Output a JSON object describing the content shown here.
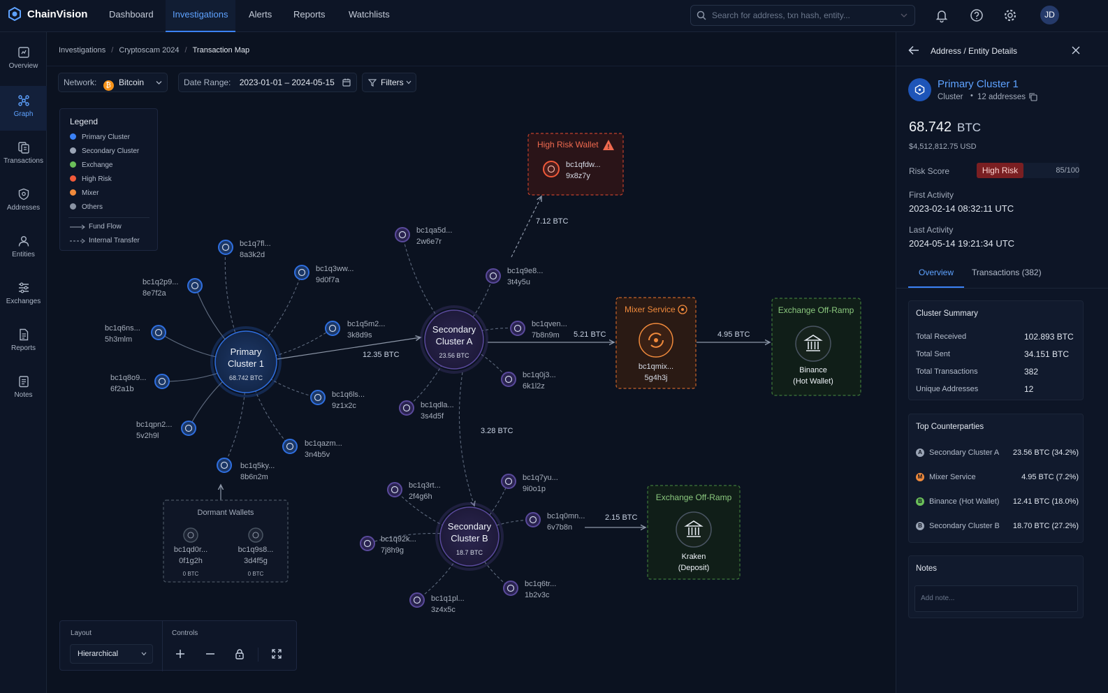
{
  "app": {
    "name": "ChainVision"
  },
  "nav": {
    "items": [
      "Dashboard",
      "Investigations",
      "Alerts",
      "Reports",
      "Watchlists"
    ],
    "active": "Investigations"
  },
  "search": {
    "placeholder": "Search for address, txn hash, entity..."
  },
  "user": {
    "initials": "JD"
  },
  "sidebar": {
    "items": [
      {
        "label": "Overview",
        "icon": "overview-icon"
      },
      {
        "label": "Graph",
        "icon": "graph-icon",
        "active": true
      },
      {
        "label": "Transactions",
        "icon": "transactions-icon"
      },
      {
        "label": "Addresses",
        "icon": "addresses-icon"
      },
      {
        "label": "Entities",
        "icon": "entities-icon"
      },
      {
        "label": "Exchanges",
        "icon": "exchanges-icon"
      },
      {
        "label": "Reports",
        "icon": "reports-icon"
      },
      {
        "label": "Notes",
        "icon": "notes-icon"
      }
    ]
  },
  "breadcrumb": [
    "Investigations",
    "Cryptoscam 2024",
    "Transaction Map"
  ],
  "toolbar": {
    "network_label": "Network:",
    "network_value": "Bitcoin",
    "date_label": "Date Range:",
    "date_value": "2023-01-01 – 2024-05-15",
    "filters_label": "Filters"
  },
  "legend": {
    "title": "Legend",
    "items": [
      {
        "label": "Primary Cluster",
        "color": "#3b82f6"
      },
      {
        "label": "Secondary Cluster",
        "color": "#9aa4b5"
      },
      {
        "label": "Exchange",
        "color": "#6bbf59"
      },
      {
        "label": "High Risk",
        "color": "#f15a3a"
      },
      {
        "label": "Mixer",
        "color": "#f08a3c"
      },
      {
        "label": "Others",
        "color": "#8a93a3"
      }
    ],
    "fund_flow": "Fund Flow",
    "internal_transfer": "Internal Transfer"
  },
  "graph": {
    "primary": {
      "name1": "Primary",
      "name2": "Cluster 1",
      "amount": "68.742 BTC"
    },
    "secondary_a": {
      "name1": "Secondary",
      "name2": "Cluster A",
      "amount": "23.56 BTC"
    },
    "secondary_b": {
      "name1": "Secondary",
      "name2": "Cluster B",
      "amount": "18.7 BTC"
    },
    "primary_nodes": [
      {
        "l1": "bc1q7fl...",
        "l2": "8a3k2d"
      },
      {
        "l1": "bc1q3ww...",
        "l2": "9d0f7a"
      },
      {
        "l1": "bc1q2p9...",
        "l2": "8e7f2a"
      },
      {
        "l1": "bc1q6ns...",
        "l2": "5h3mlm"
      },
      {
        "l1": "bc1q5m2...",
        "l2": "3k8d9s"
      },
      {
        "l1": "bc1q8o9...",
        "l2": "6f2a1b"
      },
      {
        "l1": "bc1q6ls...",
        "l2": "9z1x2c"
      },
      {
        "l1": "bc1qpn2...",
        "l2": "5v2h9l"
      },
      {
        "l1": "bc1qazm...",
        "l2": "3n4b5v"
      },
      {
        "l1": "bc1q5ky...",
        "l2": "8b6n2m"
      }
    ],
    "a_nodes": [
      {
        "l1": "bc1qa5d...",
        "l2": "2w6e7r"
      },
      {
        "l1": "bc1q9e8...",
        "l2": "3t4y5u"
      },
      {
        "l1": "bc1qven...",
        "l2": "7b8n9m"
      },
      {
        "l1": "bc1q0j3...",
        "l2": "6k1l2z"
      },
      {
        "l1": "bc1qdla...",
        "l2": "3s4d5f"
      }
    ],
    "b_nodes": [
      {
        "l1": "bc1q3rt...",
        "l2": "2f4g6h"
      },
      {
        "l1": "bc1q7yu...",
        "l2": "9i0o1p"
      },
      {
        "l1": "bc1q0mn...",
        "l2": "6v7b8n"
      },
      {
        "l1": "bc1q92k...",
        "l2": "7j8h9g"
      },
      {
        "l1": "bc1q6tr...",
        "l2": "1b2v3c"
      },
      {
        "l1": "bc1q1pl...",
        "l2": "3z4x5c"
      }
    ],
    "edges": {
      "p_to_a": "12.35 BTC",
      "a_to_risk": "7.12 BTC",
      "a_to_mixer": "5.21 BTC",
      "mixer_to_exchange": "4.95 BTC",
      "a_to_b": "3.28 BTC",
      "b_to_kraken": "2.15 BTC"
    },
    "high_risk": {
      "title": "High Risk Wallet",
      "l1": "bc1qfdw...",
      "l2": "9x8z7y"
    },
    "mixer": {
      "title": "Mixer Service",
      "l1": "bc1qmix...",
      "l2": "5g4h3j"
    },
    "binance": {
      "title": "Exchange Off-Ramp",
      "l1": "Binance",
      "l2": "(Hot Wallet)"
    },
    "kraken": {
      "title": "Exchange Off-Ramp",
      "l1": "Kraken",
      "l2": "(Deposit)"
    },
    "dormant": {
      "title": "Dormant Wallets",
      "wallets": [
        {
          "l1": "bc1qd0r...",
          "l2": "0f1g2h",
          "amt": "0 BTC"
        },
        {
          "l1": "bc1q9s8...",
          "l2": "3d4f5g",
          "amt": "0 BTC"
        }
      ]
    }
  },
  "layout_panel": {
    "title": "Layout",
    "value": "Hierarchical",
    "controls_title": "Controls"
  },
  "details": {
    "header": "Address / Entity Details",
    "entity_name": "Primary Cluster 1",
    "entity_type": "Cluster",
    "entity_count": "12 addresses",
    "balance": "68.742",
    "unit": "BTC",
    "usd": "$4,512,812.75 USD",
    "risk_label": "Risk Score",
    "risk_badge": "High Risk",
    "risk_score": "85/100",
    "first_label": "First Activity",
    "first_value": "2023-02-14 08:32:11 UTC",
    "last_label": "Last Activity",
    "last_value": "2024-05-14 19:21:34 UTC",
    "tabs": [
      "Overview",
      "Transactions (382)"
    ],
    "summary": {
      "title": "Cluster Summary",
      "rows": [
        {
          "k": "Total Received",
          "v": "102.893 BTC"
        },
        {
          "k": "Total Sent",
          "v": "34.151 BTC"
        },
        {
          "k": "Total Transactions",
          "v": "382"
        },
        {
          "k": "Unique Addresses",
          "v": "12"
        }
      ]
    },
    "counterparties": {
      "title": "Top Counterparties",
      "rows": [
        {
          "name": "Secondary Cluster A",
          "value": "23.56 BTC (34.2%)",
          "color": "#9aa4b5",
          "glyph": "A"
        },
        {
          "name": "Mixer Service",
          "value": "4.95 BTC (7.2%)",
          "color": "#f08a3c",
          "glyph": "M"
        },
        {
          "name": "Binance (Hot Wallet)",
          "value": "12.41 BTC (18.0%)",
          "color": "#6bbf59",
          "glyph": "B"
        },
        {
          "name": "Secondary Cluster B",
          "value": "18.70 BTC (27.2%)",
          "color": "#9aa4b5",
          "glyph": "B"
        }
      ]
    },
    "notes": {
      "title": "Notes",
      "placeholder": "Add note..."
    }
  }
}
